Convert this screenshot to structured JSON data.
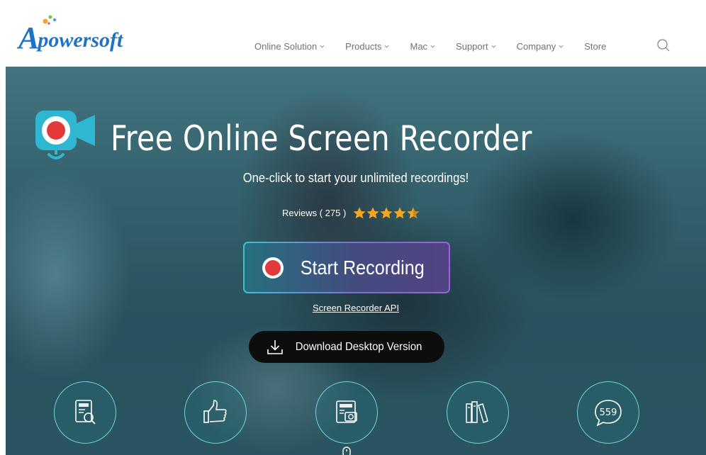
{
  "header": {
    "logo_initial": "A",
    "logo_text": "powersoft",
    "nav": [
      {
        "label": "Online Solution",
        "dropdown": true
      },
      {
        "label": "Products",
        "dropdown": true
      },
      {
        "label": "Mac",
        "dropdown": true
      },
      {
        "label": "Support",
        "dropdown": true
      },
      {
        "label": "Company",
        "dropdown": true
      },
      {
        "label": "Store",
        "dropdown": false
      }
    ]
  },
  "hero": {
    "title": "Free Online Screen Recorder",
    "subtitle": "One-click to start your unlimited recordings!",
    "reviews_label": "Reviews ( 275 )",
    "rating": 4.5,
    "star_color": "#f5a623",
    "start_button_label": "Start Recording",
    "api_link_label": "Screen Recorder API",
    "download_button_label": "Download Desktop Version"
  },
  "features": [
    {
      "icon": "document-search-icon"
    },
    {
      "icon": "thumbs-up-icon"
    },
    {
      "icon": "camera-browser-icon"
    },
    {
      "icon": "books-icon"
    },
    {
      "icon": "chat-bubble-icon",
      "count": "559"
    }
  ],
  "colors": {
    "brand_blue": "#1f73c4",
    "record_red": "#e23a3a",
    "button_gradient_start": "#3cc1d6",
    "button_gradient_end": "#9b5ee0"
  }
}
